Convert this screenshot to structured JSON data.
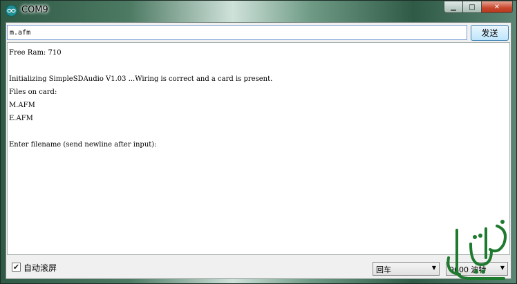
{
  "window": {
    "title": "COM9"
  },
  "input": {
    "value": "m.afm"
  },
  "send_button": {
    "label": "发送"
  },
  "console_lines": [
    "Free Ram: 710",
    "",
    "Initializing SimpleSDAudio V1.03 ...Wiring is correct and a card is present.",
    "Files on card:",
    "M.AFM",
    "E.AFM",
    "",
    "Enter filename (send newline after input):"
  ],
  "statusbar": {
    "autoscroll_label": "自动滚屏",
    "autoscroll_checked": true,
    "line_ending": "回车",
    "baud": "9600 波特"
  },
  "colors": {
    "console_bg": "#ffffff",
    "close_button": "#c7462c",
    "watermark_green": "#1e7a2e"
  }
}
